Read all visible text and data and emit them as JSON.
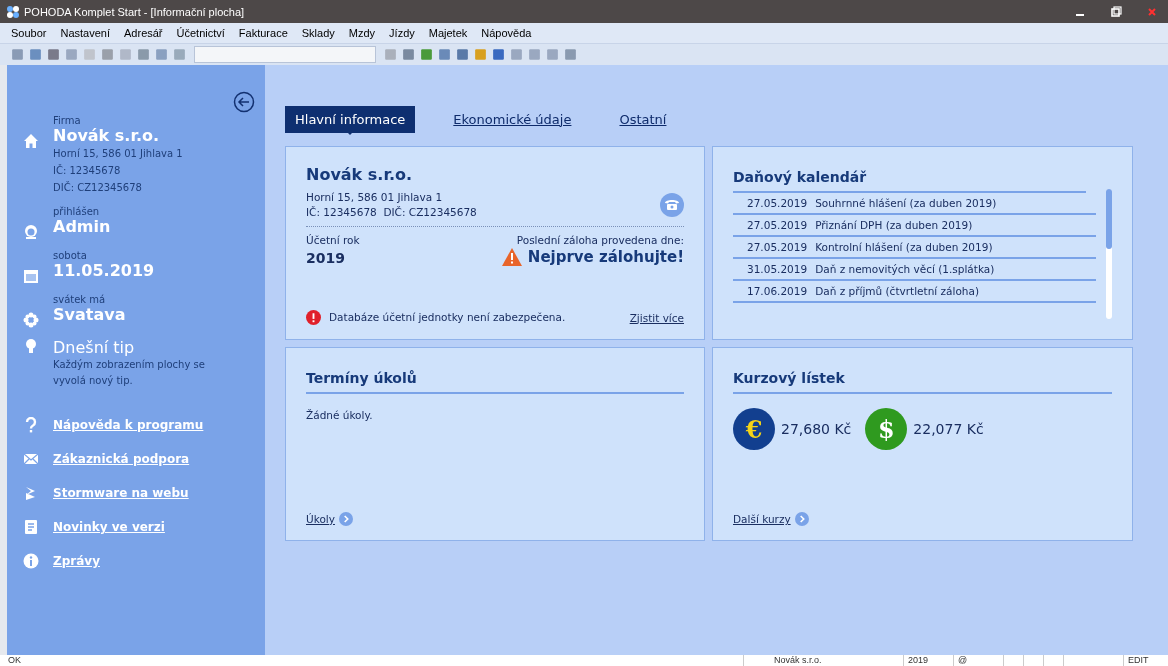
{
  "window": {
    "title": "POHODA Komplet Start - [Informační plocha]"
  },
  "menu": [
    "Soubor",
    "Nastavení",
    "Adresář",
    "Účetnictví",
    "Fakturace",
    "Sklady",
    "Mzdy",
    "Jízdy",
    "Majetek",
    "Nápověda"
  ],
  "sidebar": {
    "items": [
      {
        "kind": "info",
        "label": "Firma",
        "value": "Novák s.r.o.",
        "lines": [
          "Horní 15, 586 01 Jihlava 1",
          "IČ: 12345678",
          "DIČ: CZ12345678"
        ]
      },
      {
        "kind": "info",
        "label": "přihlášen",
        "value": "Admin"
      },
      {
        "kind": "info",
        "label": "sobota",
        "value": "11.05.2019"
      },
      {
        "kind": "info",
        "label": "svátek má",
        "value": "Svatava"
      },
      {
        "kind": "tip",
        "value": "Dnešní tip",
        "lines": [
          "Každým zobrazením plochy se",
          "vyvolá nový tip."
        ]
      },
      {
        "kind": "link",
        "value": "Nápověda k programu"
      },
      {
        "kind": "link",
        "value": "Zákaznická podpora"
      },
      {
        "kind": "link",
        "value": "Stormware na webu"
      },
      {
        "kind": "link",
        "value": "Novinky ve verzi"
      },
      {
        "kind": "link",
        "value": "Zprávy"
      }
    ]
  },
  "tabs": [
    {
      "label": "Hlavní informace",
      "selected": true
    },
    {
      "label": "Ekonomické údaje",
      "selected": false
    },
    {
      "label": "Ostatní",
      "selected": false
    }
  ],
  "company_card": {
    "name": "Novák s.r.o.",
    "address": "Horní 15, 586 01 Jihlava 1",
    "ids": "IČ: 12345678  DIČ: CZ12345678",
    "year_label": "Účetní rok",
    "year": "2019",
    "backup_label": "Poslední záloha provedena dne:",
    "backup_value": "Nejprve zálohujte!",
    "warning": "Databáze účetní jednotky není zabezpečena.",
    "warning_link": "Zjistit více"
  },
  "tax_calendar": {
    "title": "Daňový kalendář",
    "rows": [
      {
        "date": "27.05.2019",
        "text": "Souhrnné hlášení (za duben 2019)"
      },
      {
        "date": "27.05.2019",
        "text": "Přiznání DPH (za duben 2019)"
      },
      {
        "date": "27.05.2019",
        "text": "Kontrolní hlášení (za duben 2019)"
      },
      {
        "date": "31.05.2019",
        "text": "Daň z nemovitých věcí (1.splátka)"
      },
      {
        "date": "17.06.2019",
        "text": "Daň z příjmů (čtvrtletní záloha)"
      }
    ]
  },
  "tasks": {
    "title": "Termíny úkolů",
    "empty": "Žádné úkoly.",
    "link": "Úkoly"
  },
  "rates": {
    "title": "Kurzový lístek",
    "items": [
      {
        "kind": "euro",
        "symbol": "€",
        "value": "27,680 Kč"
      },
      {
        "kind": "dollar",
        "symbol": "$",
        "value": "22,077 Kč"
      }
    ],
    "link": "Další kurzy"
  },
  "status_bar": {
    "message": "OK",
    "company": "Novák s.r.o.",
    "year": "2019",
    "mail": "@",
    "mode": "EDIT"
  }
}
